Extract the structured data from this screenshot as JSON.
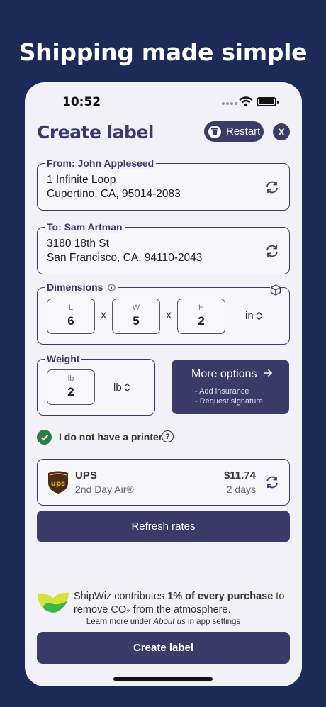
{
  "headline": "Shipping made simple",
  "status_bar": {
    "time": "10:52"
  },
  "header": {
    "title": "Create label",
    "restart_label": "Restart",
    "close_label": "X"
  },
  "from": {
    "legend": "From: John Appleseed",
    "line1": "1 Infinite Loop",
    "line2": "Cupertino, CA, 95014-2083"
  },
  "to": {
    "legend": "To: Sam Artman",
    "line1": "3180 18th St",
    "line2": "San Francisco, CA, 94110-2043"
  },
  "dimensions": {
    "legend": "Dimensions",
    "length_label": "L",
    "length_value": "6",
    "width_label": "W",
    "width_value": "5",
    "height_label": "H",
    "height_value": "2",
    "separator": "x",
    "unit": "in"
  },
  "weight": {
    "legend": "Weight",
    "label": "lb",
    "value": "2",
    "unit": "lb"
  },
  "more_options": {
    "title": "More options",
    "items": [
      "- Add insurance",
      "- Request signature"
    ]
  },
  "printer": {
    "label": "I do not have a printer",
    "help": "?",
    "checked": true
  },
  "rate": {
    "carrier": "UPS",
    "service": "2nd Day Air®",
    "price": "$11.74",
    "eta": "2 days",
    "logo_text": "ups"
  },
  "refresh_label": "Refresh rates",
  "contribution": {
    "pre": "ShipWiz contributes ",
    "bold": "1% of every purchase",
    "post": " to remove CO₂ from the atmosphere.",
    "learn_pre": "Learn more under ",
    "learn_em": "About us",
    "learn_post": " in app settings"
  },
  "create_label": "Create label",
  "colors": {
    "background": "#1b2a57",
    "accent": "#3b3a69",
    "check": "#2f7d45",
    "ups_brown": "#4a2c17",
    "ups_gold": "#f5b21b"
  }
}
